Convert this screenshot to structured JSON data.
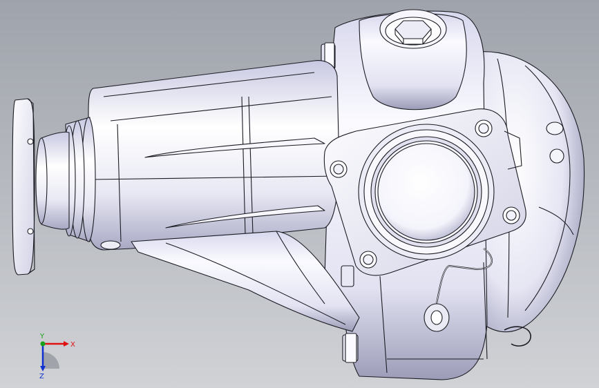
{
  "viewport": {
    "background_top": "#9fa3ab",
    "background_bottom": "#d0d2d6"
  },
  "model": {
    "name": "differential-housing",
    "shade_light": "#ffffff",
    "shade_mid": "#d9d9ee",
    "shade_dark": "#8e8ea8",
    "edge_color": "#1a1a22"
  },
  "triad": {
    "x_label": "X",
    "y_label": "Y",
    "z_label": "Z",
    "x_color": "#e01010",
    "y_color": "#18a018",
    "z_color": "#1030d0"
  }
}
